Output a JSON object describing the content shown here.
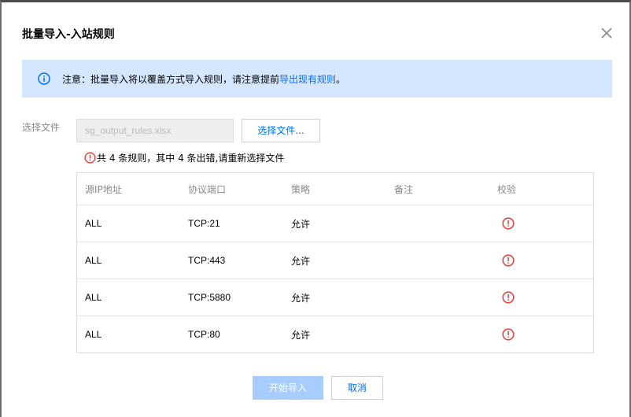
{
  "dialog": {
    "title": "批量导入-入站规则"
  },
  "notice": {
    "text": "注意：批量导入将以覆盖方式导入规则，请注意提前",
    "link": "导出现有规则",
    "end": "。"
  },
  "file": {
    "label": "选择文件",
    "value": "sg_output_rules.xlsx",
    "choose_label": "选择文件..."
  },
  "error": {
    "text": "共 4 条规则，其中 4 条出错,请重新选择文件"
  },
  "table": {
    "headers": [
      "源IP地址",
      "协议端口",
      "策略",
      "备注",
      "校验"
    ],
    "rows": [
      {
        "source": "ALL",
        "port": "TCP:21",
        "policy": "允许",
        "note": ""
      },
      {
        "source": "ALL",
        "port": "TCP:443",
        "policy": "允许",
        "note": ""
      },
      {
        "source": "ALL",
        "port": "TCP:5880",
        "policy": "允许",
        "note": ""
      },
      {
        "source": "ALL",
        "port": "TCP:80",
        "policy": "允许",
        "note": ""
      }
    ]
  },
  "footer": {
    "start_label": "开始导入",
    "cancel_label": "取消"
  },
  "colors": {
    "accent": "#006eff",
    "error": "#e54545",
    "notice_bg": "#d5e7ff",
    "start_disabled": "#a7cdff"
  },
  "icons": {
    "close": "close-icon",
    "info": "info-icon",
    "error": "error-circle-icon"
  }
}
